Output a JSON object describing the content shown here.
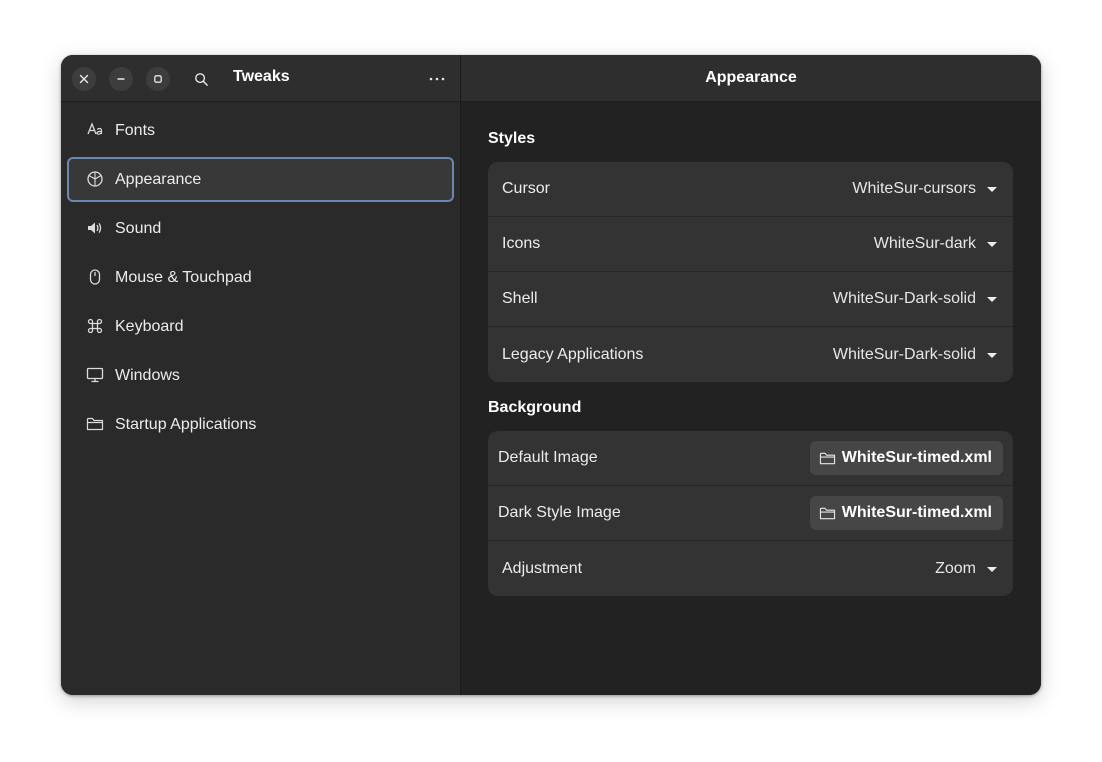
{
  "window": {
    "sidebar_title": "Tweaks",
    "content_title": "Appearance"
  },
  "sidebar": {
    "items": [
      {
        "label": "Fonts",
        "icon": "font-icon"
      },
      {
        "label": "Appearance",
        "icon": "appearance-icon",
        "selected": true
      },
      {
        "label": "Sound",
        "icon": "speaker-icon"
      },
      {
        "label": "Mouse & Touchpad",
        "icon": "mouse-icon"
      },
      {
        "label": "Keyboard",
        "icon": "command-key-icon"
      },
      {
        "label": "Windows",
        "icon": "monitor-icon"
      },
      {
        "label": "Startup Applications",
        "icon": "folder-icon"
      }
    ]
  },
  "styles": {
    "title": "Styles",
    "rows": [
      {
        "label": "Cursor",
        "value": "WhiteSur-cursors"
      },
      {
        "label": "Icons",
        "value": "WhiteSur-dark"
      },
      {
        "label": "Shell",
        "value": "WhiteSur-Dark-solid"
      },
      {
        "label": "Legacy Applications",
        "value": "WhiteSur-Dark-solid"
      }
    ]
  },
  "background": {
    "title": "Background",
    "default_image": {
      "label": "Default Image",
      "file": "WhiteSur-timed.xml"
    },
    "dark_image": {
      "label": "Dark Style Image",
      "file": "WhiteSur-timed.xml"
    },
    "adjustment": {
      "label": "Adjustment",
      "value": "Zoom"
    }
  },
  "colors": {
    "selection_border": "#6b86b1",
    "sidebar_bg": "#2a2a2a",
    "content_bg": "#222222",
    "row_bg": "#333333"
  }
}
